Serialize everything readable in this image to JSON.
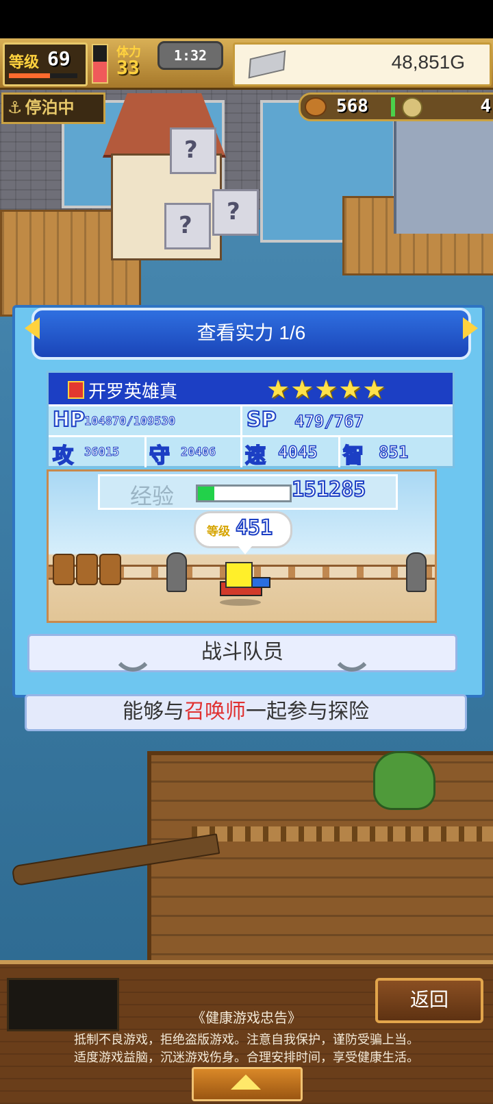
{
  "hud": {
    "level_label": "等级",
    "level_value": "69",
    "level_progress": 0.6,
    "stamina_label": "体力",
    "stamina_value": "33",
    "stamina_fill": 0.55,
    "timer": "1:32",
    "gold": "48,851G",
    "status": "停泊中",
    "food": "568",
    "medals": "4"
  },
  "dialog": {
    "title": "查看实力 1/6",
    "character_name": "开罗英雄真",
    "stars": "★★★★★",
    "star_count": 5,
    "hp_label": "HP",
    "hp_value": "104870/109530",
    "sp_label": "SP",
    "sp_value": "479/767",
    "atk_label": "攻",
    "atk_value": "36015",
    "def_label": "守",
    "def_value": "20406",
    "spd_label": "速",
    "spd_value": "4045",
    "int_label": "智",
    "int_value": "851",
    "exp_label": "经验",
    "exp_value": "151285",
    "exp_progress": 0.18,
    "level_label": "等级",
    "level_value": "451",
    "role": "战斗队员",
    "description_before": "能够与",
    "description_highlight": "召唤师",
    "description_after": "一起参与探险"
  },
  "bottom": {
    "back_label": "返回",
    "notice_title": "《健康游戏忠告》",
    "notice_line1": "抵制不良游戏，拒绝盗版游戏。注意自我保护，谨防受骗上当。",
    "notice_line2": "适度游戏益脑，沉迷游戏伤身。合理安排时间，享受健康生活。"
  },
  "colors": {
    "accent_blue": "#1c3fc4",
    "gold": "#ffd23e",
    "highlight_red": "#e03030",
    "exp_green": "#22d14a"
  },
  "icons": [
    "anchor-icon",
    "silver-bar-icon",
    "meat-icon",
    "medal-icon",
    "fire-icon",
    "arrow-left-icon",
    "arrow-right-icon",
    "up-arrow-icon"
  ]
}
